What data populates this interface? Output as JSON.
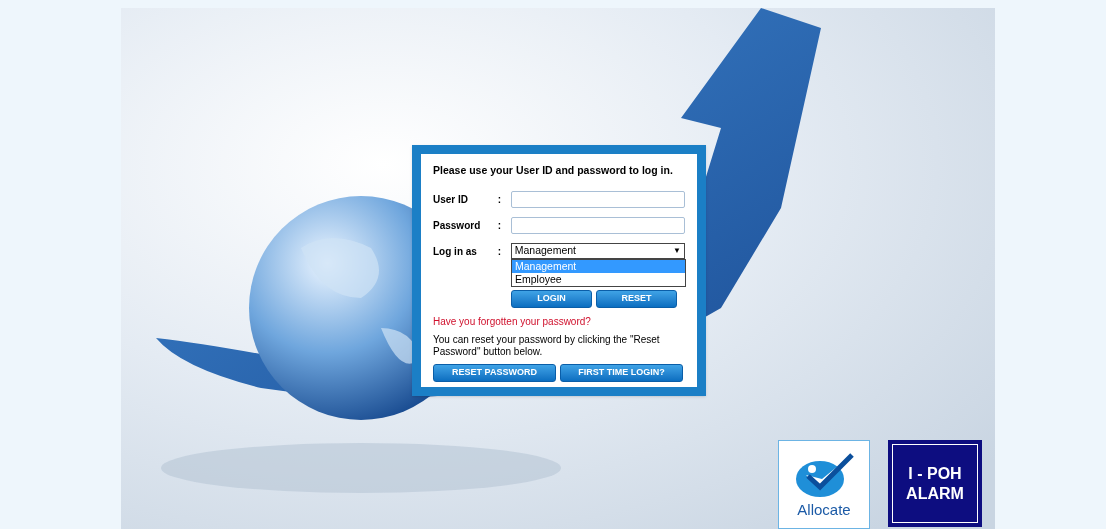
{
  "login": {
    "instruction": "Please use your User ID and password to log in.",
    "fields": [
      {
        "kind": "text",
        "label": "User ID",
        "separator": ":"
      },
      {
        "kind": "password",
        "label": "Password",
        "separator": ":"
      },
      {
        "kind": "select",
        "label": "Log in as",
        "separator": ":",
        "value": "Management",
        "arrow": "▼",
        "options": [
          {
            "label": "Management",
            "selected": true
          },
          {
            "label": "Employee",
            "selected": false
          }
        ],
        "expanded": true
      }
    ],
    "buttons": [
      "LOGIN",
      "RESET"
    ],
    "forgot_link": "Have you forgotten your password?",
    "help_text": "You can reset your password by clicking the \"Reset Password\" button below.",
    "bottom_buttons": [
      "RESET PASSWORD",
      "FIRST TIME LOGIN?"
    ]
  },
  "logos": [
    {
      "kind": "allocate",
      "text": "Allocate"
    },
    {
      "kind": "alarm",
      "lines": [
        "I - POH",
        "ALARM"
      ]
    }
  ]
}
